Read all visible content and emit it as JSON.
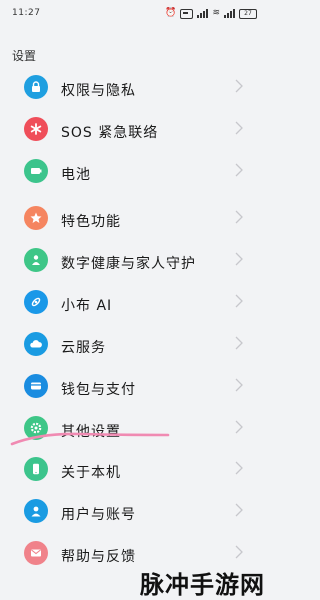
{
  "status_bar": {
    "time": "11:27",
    "battery": "27"
  },
  "page": {
    "title": "设置"
  },
  "groups": [
    {
      "items": [
        {
          "label": "权限与隐私",
          "icon": "lock-icon",
          "color": "#1f9fe0"
        },
        {
          "label": "SOS 紧急联络",
          "icon": "asterisk-icon",
          "color": "#ef4e5a"
        },
        {
          "label": "电池",
          "icon": "battery-icon",
          "color": "#3cc48c"
        }
      ]
    },
    {
      "items": [
        {
          "label": "特色功能",
          "icon": "star-icon",
          "color": "#f58560"
        },
        {
          "label": "数字健康与家人守护",
          "icon": "person-heart-icon",
          "color": "#3ec687"
        },
        {
          "label": "小布 AI",
          "icon": "assistant-icon",
          "color": "#1a98e8"
        },
        {
          "label": "云服务",
          "icon": "cloud-icon",
          "color": "#1a9be2"
        },
        {
          "label": "钱包与支付",
          "icon": "wallet-icon",
          "color": "#1a8ce0"
        },
        {
          "label": "其他设置",
          "icon": "gear-icon",
          "color": "#3ec687"
        }
      ]
    },
    {
      "items": [
        {
          "label": "关于本机",
          "icon": "phone-icon",
          "color": "#3cc48c"
        },
        {
          "label": "用户与账号",
          "icon": "user-icon",
          "color": "#1a9be2"
        },
        {
          "label": "帮助与反馈",
          "icon": "mail-icon",
          "color": "#f0828a"
        }
      ]
    }
  ],
  "watermark": "脉冲手游网",
  "highlight_color": "#f08ab2"
}
